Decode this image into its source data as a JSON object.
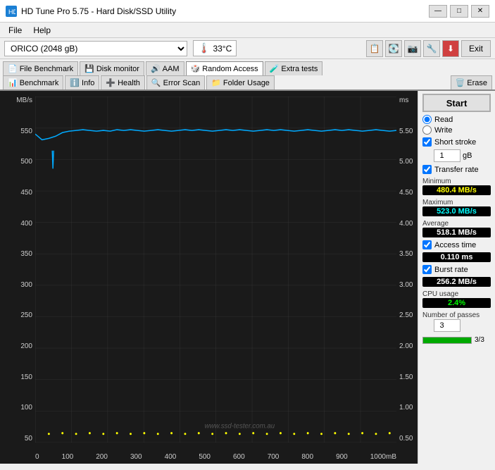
{
  "titleBar": {
    "title": "HD Tune Pro 5.75 - Hard Disk/SSD Utility",
    "minBtn": "—",
    "maxBtn": "□",
    "closeBtn": "✕"
  },
  "menuBar": {
    "items": [
      "File",
      "Help"
    ]
  },
  "toolbar": {
    "driveLabel": "ORICO (2048 gB)",
    "temperature": "33°C",
    "exitLabel": "Exit"
  },
  "tabs": {
    "row1": [
      {
        "icon": "📄",
        "label": "File Benchmark",
        "active": false
      },
      {
        "icon": "💾",
        "label": "Disk monitor",
        "active": false
      },
      {
        "icon": "🔊",
        "label": "AAM",
        "active": false
      },
      {
        "icon": "🎲",
        "label": "Random Access",
        "active": true
      },
      {
        "icon": "🧪",
        "label": "Extra tests",
        "active": false
      }
    ],
    "row2": [
      {
        "icon": "📊",
        "label": "Benchmark",
        "active": false
      },
      {
        "icon": "ℹ️",
        "label": "Info",
        "active": false
      },
      {
        "icon": "➕",
        "label": "Health",
        "active": false
      },
      {
        "icon": "🔍",
        "label": "Error Scan",
        "active": false
      },
      {
        "icon": "📁",
        "label": "Folder Usage",
        "active": false
      },
      {
        "icon": "🗑️",
        "label": "Erase",
        "active": false
      }
    ]
  },
  "chart": {
    "yAxisLeft": {
      "unit": "MB/s",
      "labels": [
        "550",
        "500",
        "450",
        "400",
        "350",
        "300",
        "250",
        "200",
        "150",
        "100",
        "50",
        "0"
      ]
    },
    "yAxisRight": {
      "unit": "ms",
      "labels": [
        "5.50",
        "5.00",
        "4.50",
        "4.00",
        "3.50",
        "3.00",
        "2.50",
        "2.00",
        "1.50",
        "1.00",
        "0.50"
      ]
    },
    "xAxisLabels": [
      "0",
      "100",
      "200",
      "300",
      "400",
      "500",
      "600",
      "700",
      "800",
      "900",
      "1000mB"
    ],
    "watermark": "www.ssd-tester.com.au"
  },
  "rightPanel": {
    "startLabel": "Start",
    "readLabel": "Read",
    "writeLabel": "Write",
    "shortStrokeLabel": "Short stroke",
    "shortStrokeValue": "1",
    "shortStrokeUnit": "gB",
    "transferRateLabel": "Transfer rate",
    "minLabel": "Minimum",
    "minValue": "480.4 MB/s",
    "maxLabel": "Maximum",
    "maxValue": "523.0 MB/s",
    "avgLabel": "Average",
    "avgValue": "518.1 MB/s",
    "accessTimeLabel": "Access time",
    "accessTimeValue": "0.110 ms",
    "burstRateLabel": "Burst rate",
    "burstRateValue": "256.2 MB/s",
    "cpuUsageLabel": "CPU usage",
    "cpuUsageValue": "2.4%",
    "passesLabel": "Number of passes",
    "passesValue": "3",
    "progressText": "3/3",
    "progressPercent": 100
  }
}
